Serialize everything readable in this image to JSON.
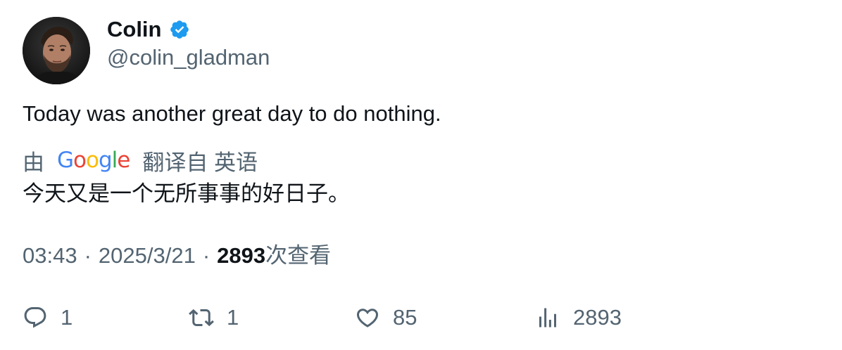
{
  "author": {
    "display_name": "Colin",
    "handle": "@colin_gladman",
    "verified_icon": "verified-badge-icon",
    "verified_color": "#1d9bf0"
  },
  "tweet": {
    "text": "Today was another great day to do nothing."
  },
  "translation": {
    "prefix": "由",
    "provider_logo": "Google",
    "suffix": "翻译自 英语",
    "text": "今天又是一个无所事事的好日子。"
  },
  "meta": {
    "time": "03:43",
    "separator": "·",
    "date": "2025/3/21",
    "views_count": "2893",
    "views_label": "次查看"
  },
  "actions": {
    "reply_count": "1",
    "retweet_count": "1",
    "like_count": "85",
    "views_count": "2893",
    "icons": [
      "reply-icon",
      "retweet-icon",
      "like-icon",
      "views-icon"
    ]
  },
  "colors": {
    "primary_text": "#0f1419",
    "secondary_text": "#536471",
    "google_blue": "#4285F4",
    "google_red": "#EA4335",
    "google_yellow": "#FBBC05",
    "google_green": "#34A853"
  }
}
